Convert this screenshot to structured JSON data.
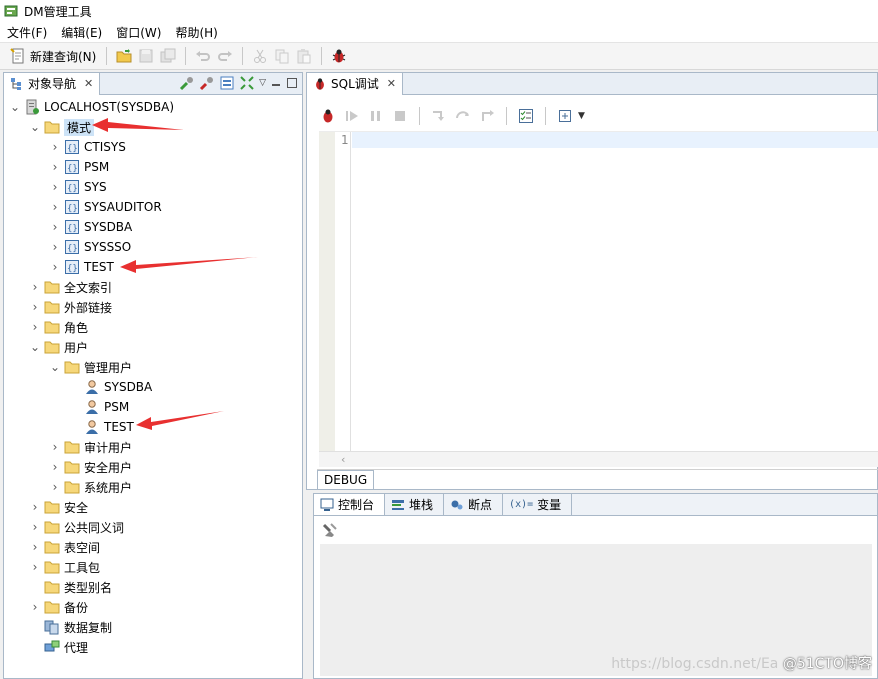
{
  "app": {
    "title": "DM管理工具"
  },
  "menu": [
    "文件(F)",
    "编辑(E)",
    "窗口(W)",
    "帮助(H)"
  ],
  "toolbar": {
    "new_query_label": "新建查询(N)"
  },
  "nav_panel": {
    "tab_label": "对象导航"
  },
  "tree": {
    "root": "LOCALHOST(SYSDBA)",
    "schema_node": "模式",
    "schemas": [
      "CTISYS",
      "PSM",
      "SYS",
      "SYSAUDITOR",
      "SYSDBA",
      "SYSSSO",
      "TEST"
    ],
    "fulltext": "全文索引",
    "external_link": "外部链接",
    "roles": "角色",
    "users": "用户",
    "admin_users": "管理用户",
    "admin_user_list": [
      "SYSDBA",
      "PSM",
      "TEST"
    ],
    "audit_users": "审计用户",
    "security_users": "安全用户",
    "system_users": "系统用户",
    "security": "安全",
    "public_synonym": "公共同义词",
    "tablespace": "表空间",
    "toolkit": "工具包",
    "type_alias": "类型别名",
    "backup": "备份",
    "replication": "数据复制",
    "agent": "代理"
  },
  "editor": {
    "tab_label": "SQL调试",
    "line_numbers": [
      "1"
    ],
    "debug_label": "DEBUG"
  },
  "bottom_tabs": [
    "控制台",
    "堆栈",
    "断点",
    "变量"
  ],
  "watermark": {
    "url": "https://blog.csdn.net/Ea",
    "brand": "@51CTO博客"
  },
  "colors": {
    "selection": "#cde3f7",
    "annotation_arrow": "#e83030",
    "panel_border": "#a9b8c8"
  }
}
